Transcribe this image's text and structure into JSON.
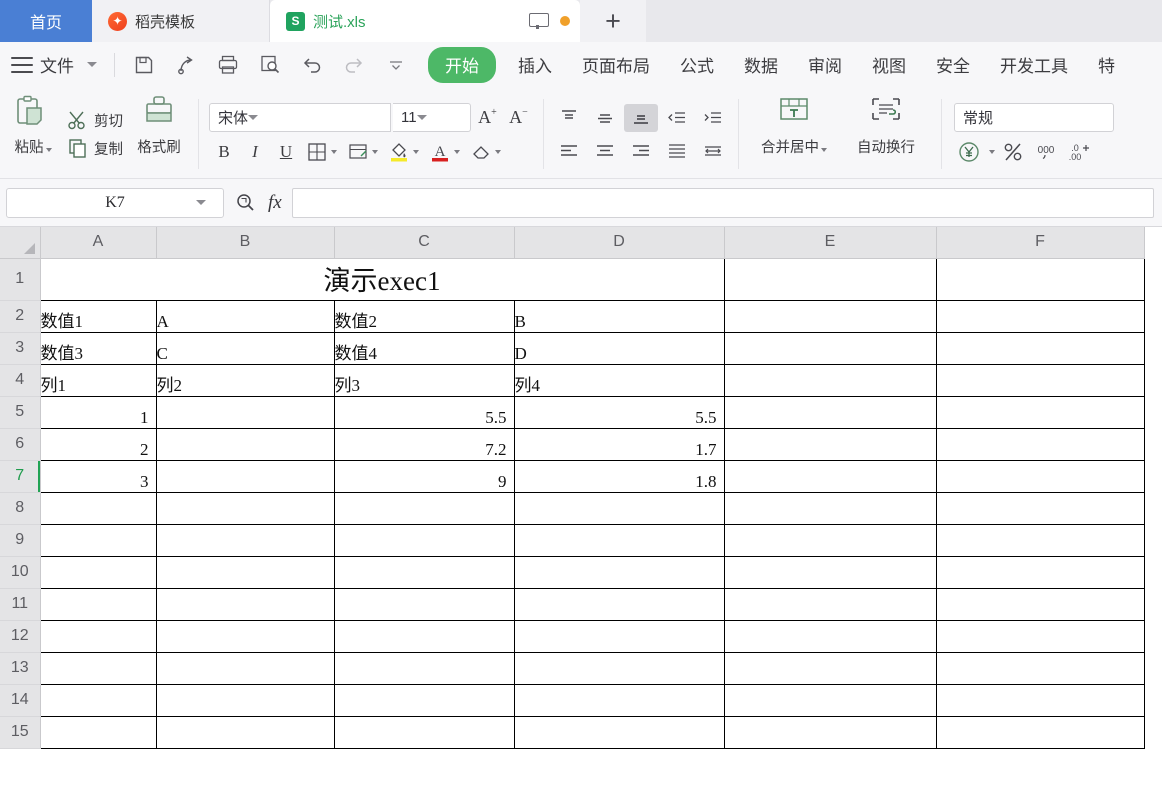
{
  "tabs": {
    "home_label": "首页",
    "docer_label": "稻壳模板",
    "docer_icon": "flame-icon",
    "file_label": "测试.xls",
    "file_icon": "spreadsheet-s-icon",
    "monitor_icon": "monitor-icon",
    "status_dot": "orange-dot-icon",
    "new_tab_label": "+"
  },
  "menubar": {
    "hamburger_icon": "hamburger-icon",
    "file_label": "文件",
    "chevron_icon": "chevron-down-icon",
    "quick_icons": [
      "save-icon",
      "share-output-icon",
      "print-icon",
      "print-preview-icon",
      "undo-icon",
      "redo-icon",
      "customize-dropdown-icon"
    ],
    "start_tab": "开始",
    "items": [
      "插入",
      "页面布局",
      "公式",
      "数据",
      "审阅",
      "视图",
      "安全",
      "开发工具",
      "特"
    ]
  },
  "ribbon": {
    "paste_label": "粘贴",
    "paste_icon": "clipboard-icon",
    "cut_label": "剪切",
    "cut_icon": "scissors-icon",
    "copy_label": "复制",
    "copy_icon": "copy-icon",
    "format_painter_label": "格式刷",
    "format_painter_icon": "paint-brush-icon",
    "font_name": "宋体",
    "font_size": "11",
    "font_grow_icon": "font-grow-icon",
    "font_shrink_icon": "font-shrink-icon",
    "bold": "B",
    "italic": "I",
    "underline": "U",
    "borders_icon": "borders-icon",
    "border_style_icon": "border-style-icon",
    "fill_color_icon": "fill-color-icon",
    "font_color_icon": "font-color-icon",
    "clear_format_icon": "eraser-icon",
    "align_top_icon": "align-top-icon",
    "align_middle_icon": "align-middle-icon",
    "align_bottom_icon": "align-bottom-icon",
    "decrease_indent_icon": "decrease-indent-icon",
    "increase_indent_icon": "increase-indent-icon",
    "align_left_icon": "align-left-icon",
    "align_center_icon": "align-center-icon",
    "align_right_icon": "align-right-icon",
    "align_justify_icon": "align-justify-icon",
    "align_distributed_icon": "align-distributed-icon",
    "merge_label": "合并居中",
    "merge_icon": "merge-cells-icon",
    "wrap_label": "自动换行",
    "wrap_icon": "wrap-text-icon",
    "number_format": "常规",
    "currency_icon": "currency-yuan-icon",
    "percent_icon": "percent-icon",
    "comma_icon": "comma-style-icon",
    "decimal_icon": "increase-decimal-icon"
  },
  "formulabar": {
    "name_box_value": "K7",
    "search_icon": "search-icon",
    "fx_label": "fx",
    "formula_value": ""
  },
  "grid": {
    "columns": [
      "A",
      "B",
      "C",
      "D",
      "E",
      "F"
    ],
    "rows": [
      "1",
      "2",
      "3",
      "4",
      "5",
      "6",
      "7",
      "8",
      "9",
      "10",
      "11",
      "12",
      "13",
      "14",
      "15"
    ],
    "selected_row": "7",
    "title_cell": "演示exec1",
    "data": [
      [
        "数值1",
        "A",
        "数值2",
        "B"
      ],
      [
        "数值3",
        "C",
        "数值4",
        "D"
      ],
      [
        "列1",
        "列2",
        "列3",
        "列4"
      ],
      [
        "1",
        "",
        "5.5",
        "5.5"
      ],
      [
        "2",
        "",
        "7.2",
        "1.7"
      ],
      [
        "3",
        "",
        "9",
        "1.8"
      ]
    ]
  },
  "colors": {
    "accent_green": "#4db867",
    "tab_blue": "#4a7fd4",
    "sheet_green": "#20a35f",
    "orange": "#f0a02a"
  }
}
